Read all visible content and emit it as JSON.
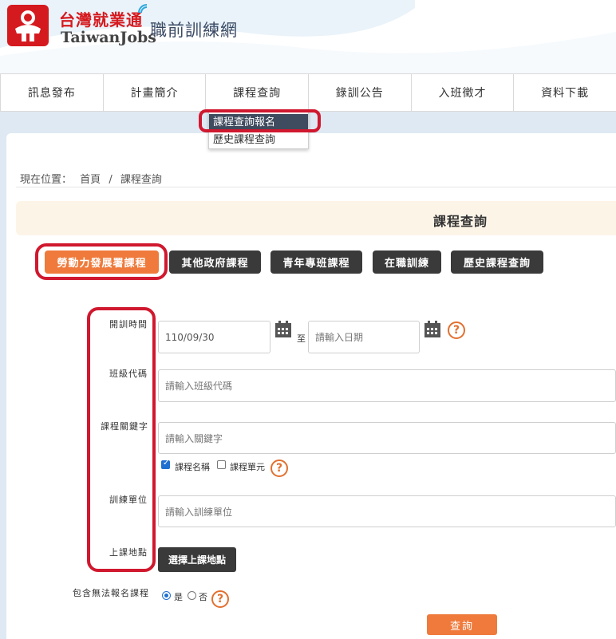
{
  "header": {
    "brand": "台灣就業通",
    "brand_en": "TaiwanJobs",
    "site_title": "職前訓練網"
  },
  "nav": {
    "items": [
      "訊息發布",
      "計畫簡介",
      "課程查詢",
      "錄訓公告",
      "入班徵才",
      "資料下載"
    ]
  },
  "dropdown": {
    "items": [
      "課程查詢報名",
      "歷史課程查詢"
    ]
  },
  "breadcrumb": {
    "label": "現在位置：",
    "home": "首頁",
    "sep": "/",
    "current": "課程查詢"
  },
  "page_title": "課程查詢",
  "tabs": [
    "勞動力發展署課程",
    "其他政府課程",
    "青年專班課程",
    "在職訓練",
    "歷史課程查詢"
  ],
  "form": {
    "start_label": "開訓時間",
    "start_value": "110/09/30",
    "to_label": "至",
    "end_placeholder": "請輸入日期",
    "class_code_label": "班級代碼",
    "class_code_placeholder": "請輸入班級代碼",
    "keyword_label": "課程關鍵字",
    "keyword_placeholder": "請輸入關鍵字",
    "opt_course_name": "課程名稱",
    "opt_course_unit": "課程單元",
    "unit_label": "訓練單位",
    "unit_placeholder": "請輸入訓練單位",
    "location_label": "上課地點",
    "location_button": "選擇上課地點",
    "include_label": "包含無法報名課程",
    "yes": "是",
    "no": "否",
    "submit": "查詢"
  },
  "colors": {
    "accent": "#ef7a3b",
    "highlight": "#d0182e",
    "dark_button": "#3a3a3a"
  }
}
